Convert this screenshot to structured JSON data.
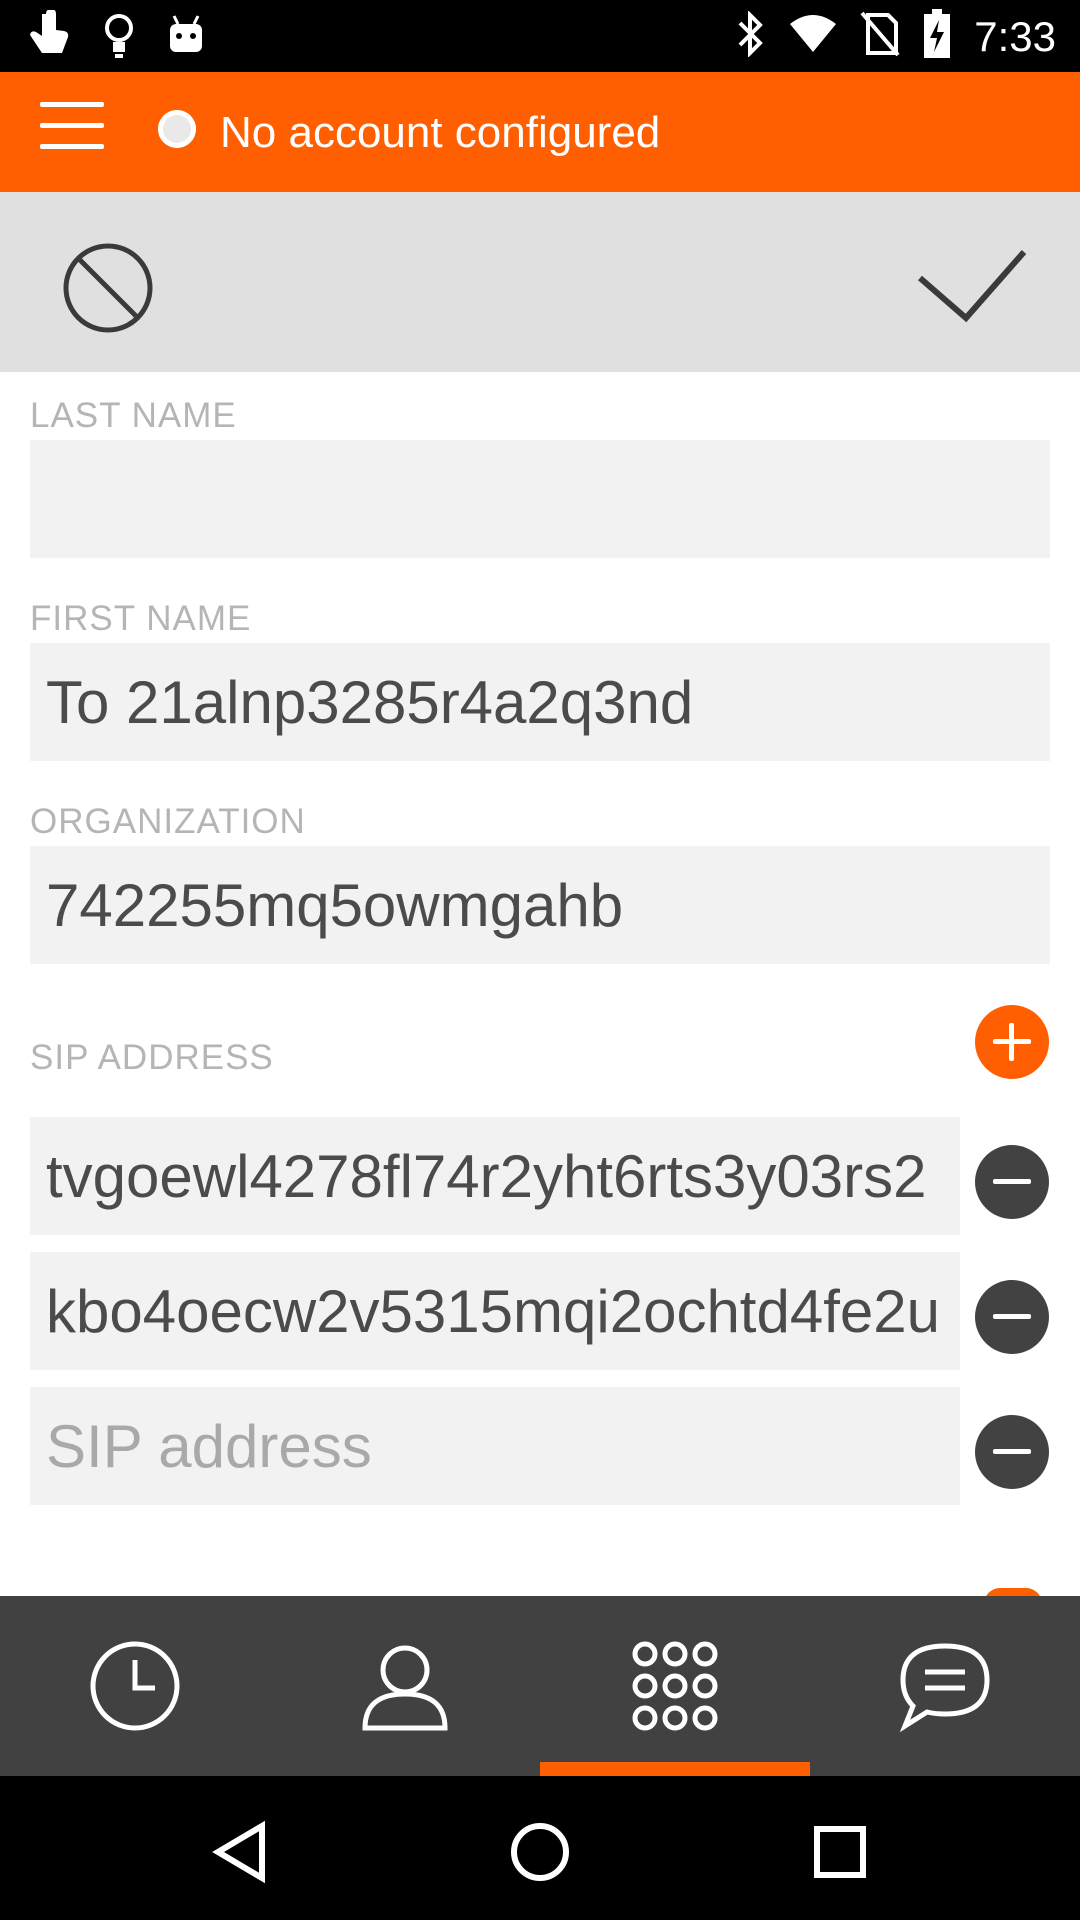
{
  "status_bar": {
    "time": "7:33",
    "left_icons": [
      "touch-icon",
      "lightbulb-icon",
      "android-icon"
    ],
    "right_icons": [
      "bluetooth-icon",
      "wifi-icon",
      "no-sim-icon",
      "battery-charging-icon"
    ]
  },
  "app_bar": {
    "account_status": "No account configured"
  },
  "form": {
    "last_name": {
      "label": "LAST NAME",
      "value": ""
    },
    "first_name": {
      "label": "FIRST NAME",
      "value": "To 21alnp3285r4a2q3nd"
    },
    "organization": {
      "label": "ORGANIZATION",
      "value": "742255mq5owmgahb"
    },
    "sip": {
      "label": "SIP ADDRESS",
      "entries": [
        "tvgoewl4278fl74r2yht6rts3y03rs2",
        "kbo4oecw2v5315mqi2ochtd4fe2u"
      ],
      "placeholder": "SIP address"
    }
  },
  "tabs": [
    {
      "name": "history",
      "icon": "clock-icon"
    },
    {
      "name": "contacts",
      "icon": "person-icon"
    },
    {
      "name": "dialer",
      "icon": "dialpad-icon",
      "selected": true
    },
    {
      "name": "chat",
      "icon": "chat-icon"
    }
  ],
  "colors": {
    "accent": "#ff5f00",
    "tabbar": "#414141",
    "actionbar": "#e0e0e0"
  }
}
